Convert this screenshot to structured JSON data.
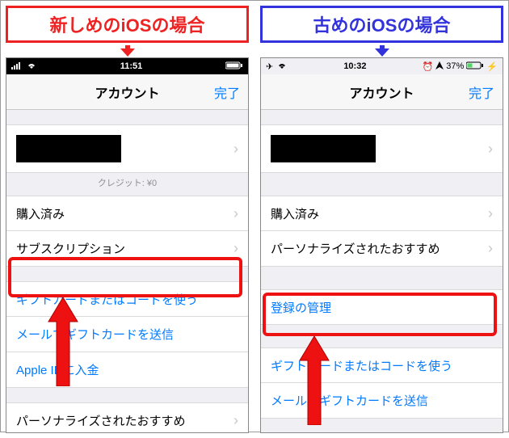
{
  "left": {
    "caption": "新しめのiOSの場合",
    "status_time": "11:51",
    "nav_title": "アカウント",
    "nav_done": "完了",
    "credit": "クレジット: ¥0",
    "purchased": "購入済み",
    "subscription": "サブスクリプション",
    "redeem": "ギフトカードまたはコードを使う",
    "send_gift": "メールでギフトカードを送信",
    "add_funds": "Apple IDに入金",
    "personalized": "パーソナライズされたおすすめ"
  },
  "right": {
    "caption": "古めのiOSの場合",
    "status_time": "10:32",
    "status_battery": "37%",
    "nav_title": "アカウント",
    "nav_done": "完了",
    "purchased": "購入済み",
    "personalized": "パーソナライズされたおすすめ",
    "manage_sub": "登録の管理",
    "redeem": "ギフトカードまたはコードを使う",
    "send_gift": "メールでギフトカードを送信"
  }
}
